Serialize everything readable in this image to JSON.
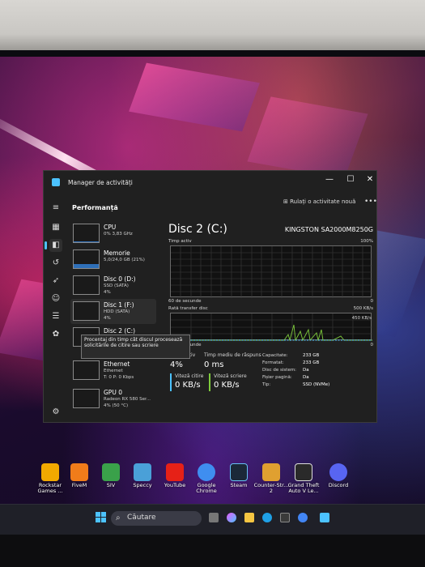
{
  "window": {
    "app_title": "Manager de activități",
    "section_title": "Performanță",
    "run_new_task": "Rulați o activitate nouă",
    "more": "•••",
    "minimize": "—",
    "maximize": "☐",
    "close": "✕"
  },
  "resources": [
    {
      "name": "CPU",
      "line1": "0% 3,83 GHz",
      "line2": "",
      "fill": 0.02
    },
    {
      "name": "Memorie",
      "line1": "5,0/24,0 GB (21%)",
      "line2": "",
      "fill": 0.21
    },
    {
      "name": "Disc 0 (D:)",
      "line1": "SSD (SATA)",
      "line2": "4%",
      "fill": 0.04
    },
    {
      "name": "Disc 1 (F:)",
      "line1": "HDD (SATA)",
      "line2": "4%",
      "fill": 0.04
    },
    {
      "name": "Disc 2 (C:)",
      "line1": "",
      "line2": "",
      "fill": 0.0
    },
    {
      "name": "Ethernet",
      "line1": "Ethernet",
      "line2": "T: 0 P: 0 Kbps",
      "fill": 0.0
    },
    {
      "name": "GPU 0",
      "line1": "Radeon RX 580 Ser...",
      "line2": "4% (50 °C)",
      "fill": 0.04
    }
  ],
  "tooltip": "Procentaj din timp cât discul procesează solicitările de citire sau scriere",
  "detail": {
    "title": "Disc 2 (C:)",
    "model": "KINGSTON SA2000M8250G",
    "graph1": {
      "label": "Timp activ",
      "max": "100%",
      "xlabel": "60 de secunde",
      "min": "0"
    },
    "graph2": {
      "label": "Rată transfer disc",
      "max": "500 KB/s",
      "mark": "450 KB/s",
      "xlabel": "60 de secunde",
      "min": "0"
    },
    "active_time_label": "Timp activ",
    "active_time_value": "4%",
    "response_label": "Timp mediu de răspuns",
    "response_value": "0 ms",
    "read_label": "Viteză citire",
    "read_value": "0 KB/s",
    "write_label": "Viteză scriere",
    "write_value": "0 KB/s",
    "props": [
      {
        "k": "Capacitate:",
        "v": "233 GB"
      },
      {
        "k": "Formatat:",
        "v": "233 GB"
      },
      {
        "k": "Disc de sistem:",
        "v": "Da"
      },
      {
        "k": "Fișier pagină:",
        "v": "Da"
      },
      {
        "k": "Tip:",
        "v": "SSD (NVMe)"
      }
    ],
    "colors": {
      "read": "#4cc2ff",
      "write": "#7ecb3c"
    }
  },
  "desktop_icons": [
    {
      "label": "Rockstar Games ...",
      "color": "#f2a900"
    },
    {
      "label": "FiveM",
      "color": "#f07c1a"
    },
    {
      "label": "SIV",
      "color": "#3aa14a"
    },
    {
      "label": "Speccy",
      "color": "#4aa0d8"
    },
    {
      "label": "YouTube",
      "color": "#e62117"
    },
    {
      "label": "Google Chrome",
      "color": "#3f8ef0"
    },
    {
      "label": "Steam",
      "color": "#1b2838"
    },
    {
      "label": "Counter-Str... 2",
      "color": "#e0a030"
    },
    {
      "label": "Grand Theft Auto V Le...",
      "color": "#2a2a2a"
    },
    {
      "label": "Discord",
      "color": "#5865f2"
    }
  ],
  "taskbar": {
    "search_placeholder": "Căutare",
    "search_icon": "search-icon"
  }
}
